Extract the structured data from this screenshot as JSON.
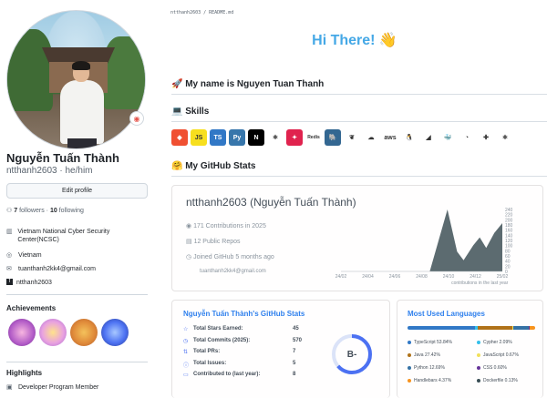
{
  "profile": {
    "display_name": "Nguyễn Tuấn Thành",
    "username_line": "ntthanh2603 · he/him",
    "edit_label": "Edit profile",
    "followers_count": "7",
    "followers_label": "followers",
    "following_count": "10",
    "following_label": "following",
    "organization": "Vietnam National Cyber Security Center(NCSC)",
    "location": "Vietnam",
    "email": "tuanthanh2kk4@gmail.com",
    "facebook": "ntthanh2603"
  },
  "achievements": {
    "title": "Achievements"
  },
  "highlights": {
    "title": "Highlights",
    "item": "Developer Program Member"
  },
  "readme": {
    "path": "ntthanh2603 / README.md",
    "hi": "Hi There! 👋",
    "name_heading": "🚀 My name is Nguyen Tuan Thanh",
    "skills_heading": "💻 Skills",
    "stats_heading": "🤗 My GitHub Stats",
    "skills": [
      {
        "name": "git",
        "color": "#f05032",
        "glyph": "◆"
      },
      {
        "name": "js",
        "color": "#f7df1e",
        "glyph": "JS"
      },
      {
        "name": "ts",
        "color": "#3178c6",
        "glyph": "TS"
      },
      {
        "name": "python",
        "color": "#3776ab",
        "glyph": "Py"
      },
      {
        "name": "nextjs",
        "color": "#000000",
        "glyph": "N"
      },
      {
        "name": "react",
        "color": "#ffffff",
        "glyph": "⚛"
      },
      {
        "name": "nestjs",
        "color": "#e0234e",
        "glyph": "✦"
      },
      {
        "name": "redis",
        "color": "#ffffff",
        "glyph": "Redis"
      },
      {
        "name": "postgres",
        "color": "#336791",
        "glyph": "🐘"
      },
      {
        "name": "mongodb",
        "color": "#ffffff",
        "glyph": "❦"
      },
      {
        "name": "gcp",
        "color": "#ffffff",
        "glyph": "☁"
      },
      {
        "name": "aws",
        "color": "#ffffff",
        "glyph": "aws"
      },
      {
        "name": "linux",
        "color": "#ffffff",
        "glyph": "🐧"
      },
      {
        "name": "flutter",
        "color": "#ffffff",
        "glyph": "◢"
      },
      {
        "name": "docker",
        "color": "#ffffff",
        "glyph": "🐳"
      },
      {
        "name": "rabbitmq",
        "color": "#ffffff",
        "glyph": "◔"
      },
      {
        "name": "tensorflow",
        "color": "#ffffff",
        "glyph": "✚"
      },
      {
        "name": "react2",
        "color": "#ffffff",
        "glyph": "⚛"
      }
    ]
  },
  "activity": {
    "title": "ntthanh2603 (Nguyễn Tuấn Thành)",
    "contributions": "171 Contributions in 2025",
    "repos": "12 Public Repos",
    "joined": "Joined GitHub 5 months ago",
    "email": "tuanthanh2kk4@gmail.com",
    "xlabel": "contributions in the last year"
  },
  "chart_data": {
    "type": "area",
    "categories": [
      "24/02",
      "24/04",
      "24/06",
      "24/08",
      "24/10",
      "24/12",
      "25/02"
    ],
    "values": [
      0,
      0,
      0,
      0,
      240,
      150,
      190
    ],
    "x_ticks": [
      "24/02",
      "24/04",
      "24/06",
      "24/08",
      "24/10",
      "24/12",
      "25/02"
    ],
    "y_ticks": [
      "240",
      "220",
      "200",
      "180",
      "160",
      "140",
      "120",
      "100",
      "80",
      "60",
      "40",
      "20",
      "0"
    ],
    "ylim": [
      0,
      240
    ],
    "xlabel": "contributions in the last year",
    "color": "#5c6b70"
  },
  "stats": {
    "title": "Nguyễn Tuấn Thành's GitHub Stats",
    "rows": [
      {
        "label": "Total Stars Earned:",
        "value": "45"
      },
      {
        "label": "Total Commits (2025):",
        "value": "570"
      },
      {
        "label": "Total PRs:",
        "value": "7"
      },
      {
        "label": "Total Issues:",
        "value": "5"
      },
      {
        "label": "Contributed to (last year):",
        "value": "8"
      }
    ],
    "grade": "B-"
  },
  "languages": {
    "title": "Most Used Languages",
    "items": [
      {
        "name": "TypeScript 53.84%",
        "color": "#3178c6",
        "pct": 53.84
      },
      {
        "name": "Cypher 2.09%",
        "color": "#34c0eb",
        "pct": 2.09
      },
      {
        "name": "Java 27.42%",
        "color": "#b07219",
        "pct": 27.42
      },
      {
        "name": "JavaScript 0.67%",
        "color": "#f1e05a",
        "pct": 0.67
      },
      {
        "name": "Python 12.69%",
        "color": "#3572a5",
        "pct": 12.69
      },
      {
        "name": "CSS 0.60%",
        "color": "#663399",
        "pct": 0.6
      },
      {
        "name": "Handlebars 4.37%",
        "color": "#f7931e",
        "pct": 4.37
      },
      {
        "name": "Dockerfile 0.13%",
        "color": "#384d54",
        "pct": 0.13
      }
    ]
  }
}
